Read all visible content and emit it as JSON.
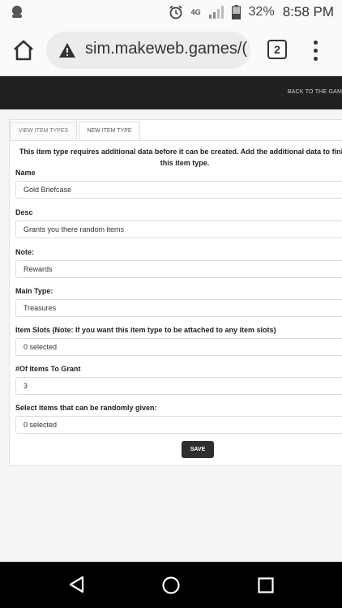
{
  "status_bar": {
    "battery": "32%",
    "clock": "8:58 PM",
    "network": "4G"
  },
  "browser": {
    "url": "sim.makeweb.games/(",
    "tab_count": "2"
  },
  "header": {
    "back_link": "BACK TO THE GAM"
  },
  "tabs": [
    {
      "label": "VIEW ITEM TYPES"
    },
    {
      "label": "NEW ITEM TYPE"
    }
  ],
  "form": {
    "notice_line1": "This item type requires additional data before it can be created. Add the additional data to finis",
    "notice_line2": "this item type.",
    "name_label": "Name",
    "name_value": "Gold Briefcase",
    "desc_label": "Desc",
    "desc_value": "Grants you there random items",
    "note_label": "Note:",
    "note_value": "Rewards",
    "main_type_label": "Main Type:",
    "main_type_value": "Treasures",
    "item_slots_label": "Item Slots (Note: If you want this item type to be attached to any item slots)",
    "item_slots_value": "0 selected",
    "items_to_grant_label": "#Of Items To Grant",
    "items_to_grant_value": "3",
    "random_items_label": "Select items that can be randomly given:",
    "random_items_value": "0 selected",
    "save_label": "SAVE"
  },
  "colors": {
    "header_bg": "#212121",
    "save_bg": "#2f2f2f"
  }
}
